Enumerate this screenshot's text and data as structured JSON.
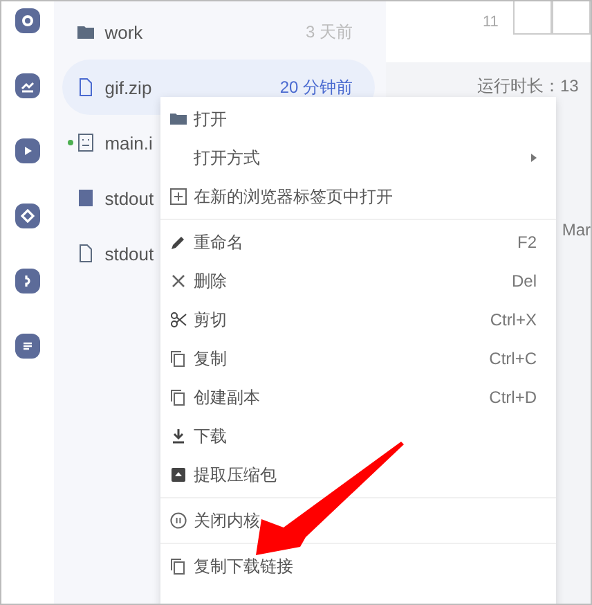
{
  "files": [
    {
      "name": "work",
      "time": "3 天前",
      "kind": "folder",
      "selected": false,
      "running": false
    },
    {
      "name": "gif.zip",
      "time": "20 分钟前",
      "kind": "file",
      "selected": true,
      "running": false
    },
    {
      "name": "main.i",
      "kind": "notebook",
      "selected": false,
      "running": true
    },
    {
      "name": "stdout",
      "kind": "block",
      "selected": false,
      "running": false
    },
    {
      "name": "stdout",
      "kind": "file",
      "selected": false,
      "running": false
    }
  ],
  "right_panel": {
    "row_number": "11",
    "runtime_label": "运行时长：13",
    "column_text": "Mar"
  },
  "context_menu": {
    "groups": [
      [
        {
          "label": "打开",
          "kind": "folder"
        },
        {
          "label": "打开方式",
          "kind": "submenu"
        },
        {
          "label": "在新的浏览器标签页中打开",
          "kind": "plus"
        }
      ],
      [
        {
          "label": "重命名",
          "kind": "pencil",
          "shortcut": "F2"
        },
        {
          "label": "删除",
          "kind": "cross",
          "shortcut": "Del"
        },
        {
          "label": "剪切",
          "kind": "scissors",
          "shortcut": "Ctrl+X"
        },
        {
          "label": "复制",
          "kind": "copy",
          "shortcut": "Ctrl+C"
        },
        {
          "label": "创建副本",
          "kind": "copy",
          "shortcut": "Ctrl+D"
        },
        {
          "label": "下载",
          "kind": "download"
        },
        {
          "label": "提取压缩包",
          "kind": "archive"
        }
      ],
      [
        {
          "label": "关闭内核",
          "kind": "pause"
        }
      ],
      [
        {
          "label": "复制下载链接",
          "kind": "copy"
        }
      ]
    ]
  }
}
